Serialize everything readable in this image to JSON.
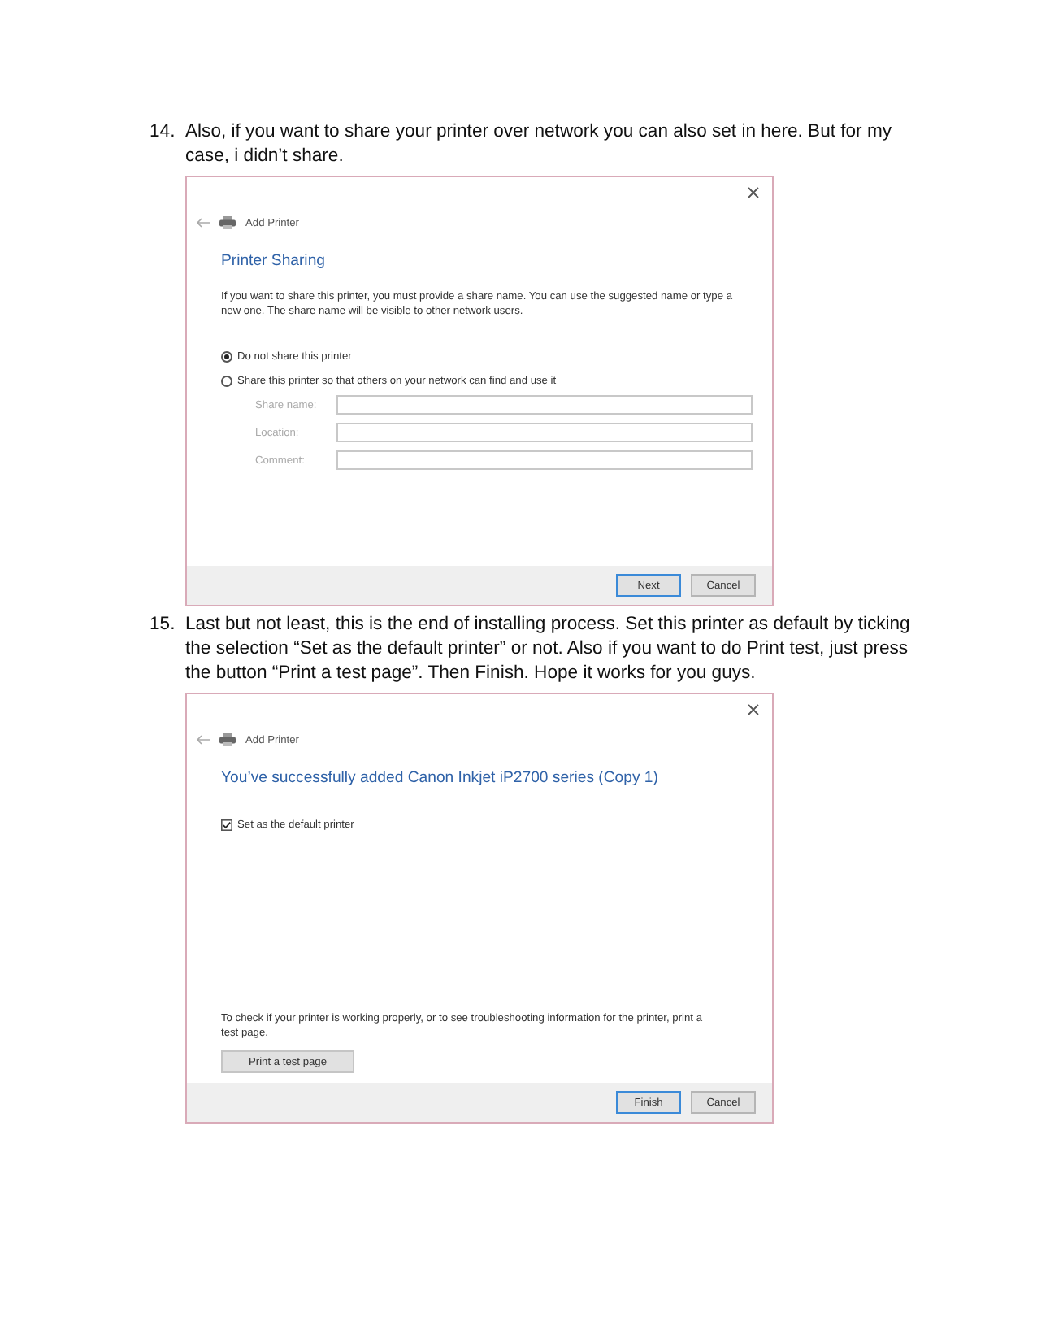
{
  "steps": [
    {
      "number": "14.",
      "text": "Also, if you want to share your printer over network you can also set in here. But for my case, i didn’t share.",
      "dialog": {
        "title": "Add Printer",
        "heading": "Printer Sharing",
        "body": [
          {
            "kind": "paragraph",
            "text": "If you want to share this printer, you must provide a share name. You can use the suggested name or type a new one. The share name will be visible to other network users."
          },
          {
            "kind": "radio",
            "label": "Do not share this printer",
            "selected": true
          },
          {
            "kind": "radio",
            "label": "Share this printer so that others on your network can find and use it",
            "selected": false
          },
          {
            "kind": "field",
            "label": "Share name:",
            "disabled": true
          },
          {
            "kind": "field",
            "label": "Location:",
            "disabled": true
          },
          {
            "kind": "field",
            "label": "Comment:",
            "disabled": true
          }
        ],
        "buttons": [
          {
            "label": "Next",
            "default": true
          },
          {
            "label": "Cancel",
            "default": false
          }
        ]
      }
    },
    {
      "number": "15.",
      "text": "Last but not least, this is the end of installing process. Set this printer as default by ticking the selection “Set as the default printer” or not. Also if you want to do Print test, just press the button “Print a test page”. Then Finish. Hope it works for you guys.",
      "dialog": {
        "title": "Add Printer",
        "heading": "You’ve successfully added Canon Inkjet iP2700 series (Copy 1)",
        "body": [
          {
            "kind": "checkbox",
            "label": "Set as the default printer",
            "checked": true
          },
          {
            "kind": "note",
            "text": "To check if your printer is working properly, or to see troubleshooting information for the printer, print a test page."
          },
          {
            "kind": "push",
            "label": "Print a test page"
          }
        ],
        "buttons": [
          {
            "label": "Finish",
            "default": true
          },
          {
            "label": "Cancel",
            "default": false
          }
        ]
      }
    }
  ]
}
